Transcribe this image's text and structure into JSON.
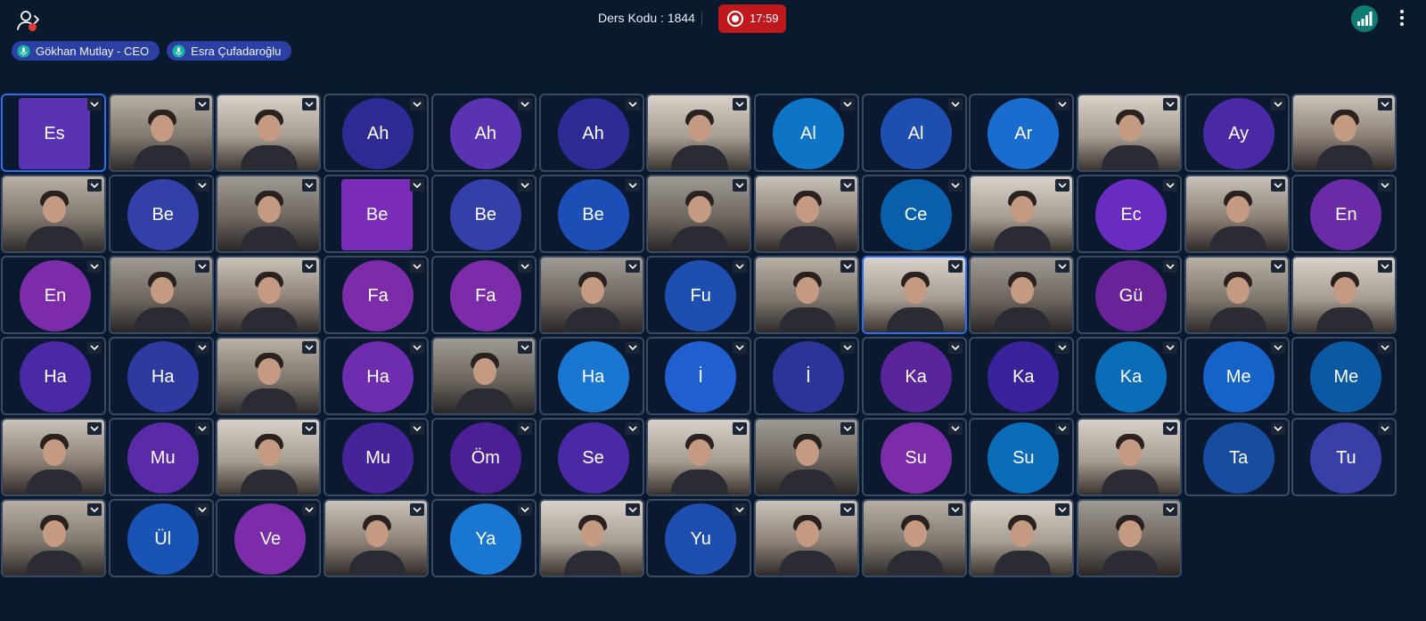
{
  "header": {
    "course_code_label": "Ders Kodu : 1844",
    "recording_time": "17:59"
  },
  "speakers": [
    {
      "name": "Gökhan Mutlay - CEO"
    },
    {
      "name": "Esra Çufadaroğlu"
    }
  ],
  "colors": {
    "accent_record": "#c0191d",
    "signal": "#0f7c74",
    "pill": "#2c3fa3"
  },
  "participants": [
    {
      "type": "avatar",
      "initials": "Es",
      "color": "#5a33b3",
      "shape": "square",
      "active": true
    },
    {
      "type": "video"
    },
    {
      "type": "video"
    },
    {
      "type": "avatar",
      "initials": "Ah",
      "color": "#2f2b95"
    },
    {
      "type": "avatar",
      "initials": "Ah",
      "color": "#5a33b3"
    },
    {
      "type": "avatar",
      "initials": "Ah",
      "color": "#2f2b95"
    },
    {
      "type": "video"
    },
    {
      "type": "avatar",
      "initials": "Al",
      "color": "#0e74c5"
    },
    {
      "type": "avatar",
      "initials": "Al",
      "color": "#1e4fb0"
    },
    {
      "type": "avatar",
      "initials": "Ar",
      "color": "#1a6dcf"
    },
    {
      "type": "video"
    },
    {
      "type": "avatar",
      "initials": "Ay",
      "color": "#4a2aa4"
    },
    {
      "type": "video"
    },
    {
      "type": "video"
    },
    {
      "type": "avatar",
      "initials": "Be",
      "color": "#3340a8"
    },
    {
      "type": "video"
    },
    {
      "type": "avatar",
      "initials": "Be",
      "color": "#7a2cb8",
      "shape": "square"
    },
    {
      "type": "avatar",
      "initials": "Be",
      "color": "#3340a8"
    },
    {
      "type": "avatar",
      "initials": "Be",
      "color": "#1b4fb5"
    },
    {
      "type": "video"
    },
    {
      "type": "video"
    },
    {
      "type": "avatar",
      "initials": "Ce",
      "color": "#0a5fad"
    },
    {
      "type": "video"
    },
    {
      "type": "avatar",
      "initials": "Ec",
      "color": "#6a2cc0"
    },
    {
      "type": "video"
    },
    {
      "type": "avatar",
      "initials": "En",
      "color": "#6b2aa6"
    },
    {
      "type": "avatar",
      "initials": "En",
      "color": "#7c2ca8"
    },
    {
      "type": "video"
    },
    {
      "type": "video"
    },
    {
      "type": "avatar",
      "initials": "Fa",
      "color": "#7c2ca8"
    },
    {
      "type": "avatar",
      "initials": "Fa",
      "color": "#7c2ca8"
    },
    {
      "type": "video"
    },
    {
      "type": "avatar",
      "initials": "Fu",
      "color": "#1e4fb0"
    },
    {
      "type": "video"
    },
    {
      "type": "video",
      "active": true
    },
    {
      "type": "video"
    },
    {
      "type": "avatar",
      "initials": "Gü",
      "color": "#6a2299"
    },
    {
      "type": "video"
    },
    {
      "type": "video"
    },
    {
      "type": "avatar",
      "initials": "Ha",
      "color": "#4a2aa4"
    },
    {
      "type": "avatar",
      "initials": "Ha",
      "color": "#2f3aa0"
    },
    {
      "type": "video"
    },
    {
      "type": "avatar",
      "initials": "Ha",
      "color": "#6e2cae"
    },
    {
      "type": "video"
    },
    {
      "type": "avatar",
      "initials": "Ha",
      "color": "#1a77d1"
    },
    {
      "type": "avatar",
      "initials": "İ",
      "color": "#1f5fd0"
    },
    {
      "type": "avatar",
      "initials": "İ",
      "color": "#2b3597"
    },
    {
      "type": "avatar",
      "initials": "Ka",
      "color": "#5a249a"
    },
    {
      "type": "avatar",
      "initials": "Ka",
      "color": "#3a239a"
    },
    {
      "type": "avatar",
      "initials": "Ka",
      "color": "#0b6db8"
    },
    {
      "type": "avatar",
      "initials": "Me",
      "color": "#1563c8"
    },
    {
      "type": "avatar",
      "initials": "Me",
      "color": "#0b59a2"
    },
    {
      "type": "video"
    },
    {
      "type": "avatar",
      "initials": "Mu",
      "color": "#5a2aa8"
    },
    {
      "type": "video"
    },
    {
      "type": "avatar",
      "initials": "Mu",
      "color": "#47239a"
    },
    {
      "type": "avatar",
      "initials": "Öm",
      "color": "#4d1f95"
    },
    {
      "type": "avatar",
      "initials": "Se",
      "color": "#4a2aa4"
    },
    {
      "type": "video"
    },
    {
      "type": "video"
    },
    {
      "type": "avatar",
      "initials": "Su",
      "color": "#7c2ca8"
    },
    {
      "type": "avatar",
      "initials": "Su",
      "color": "#0b6db8"
    },
    {
      "type": "video"
    },
    {
      "type": "avatar",
      "initials": "Ta",
      "color": "#174c9e"
    },
    {
      "type": "avatar",
      "initials": "Tu",
      "color": "#3a3fa8"
    },
    {
      "type": "video"
    },
    {
      "type": "avatar",
      "initials": "Ül",
      "color": "#1a53b6"
    },
    {
      "type": "avatar",
      "initials": "Ve",
      "color": "#7c2ca8"
    },
    {
      "type": "video"
    },
    {
      "type": "avatar",
      "initials": "Ya",
      "color": "#1a77d1"
    },
    {
      "type": "video"
    },
    {
      "type": "avatar",
      "initials": "Yu",
      "color": "#1e4fb0"
    },
    {
      "type": "video"
    },
    {
      "type": "video"
    },
    {
      "type": "video"
    },
    {
      "type": "video"
    }
  ]
}
